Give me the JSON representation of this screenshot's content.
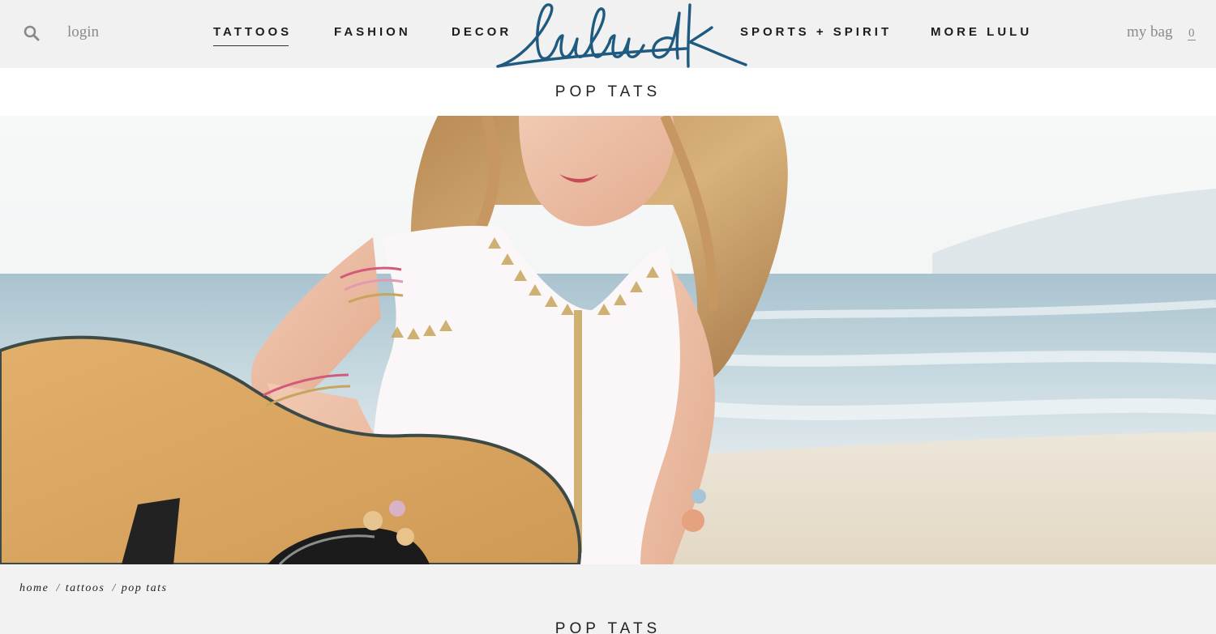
{
  "header": {
    "login_label": "login",
    "nav": [
      {
        "label": "TATTOOS",
        "active": true
      },
      {
        "label": "FASHION",
        "active": false
      },
      {
        "label": "DECOR",
        "active": false
      },
      {
        "label": "SPORTS + SPIRIT",
        "active": false
      },
      {
        "label": "MORE LULU",
        "active": false
      }
    ],
    "logo_text": "lulu dk",
    "bag_label": "my bag",
    "bag_count": "0"
  },
  "subbar": {
    "title": "POP TATS"
  },
  "breadcrumb": {
    "items": [
      "home",
      "tattoos",
      "pop tats"
    ],
    "separator": "/"
  },
  "page_title": "POP TATS",
  "icons": {
    "search": "search-icon",
    "logo": "lulu-dk-logo"
  },
  "colors": {
    "logo_blue": "#1f5a80",
    "header_bg": "#f1f1f1",
    "nav_text": "#1c1c1c",
    "muted_text": "#8a8a8a"
  }
}
